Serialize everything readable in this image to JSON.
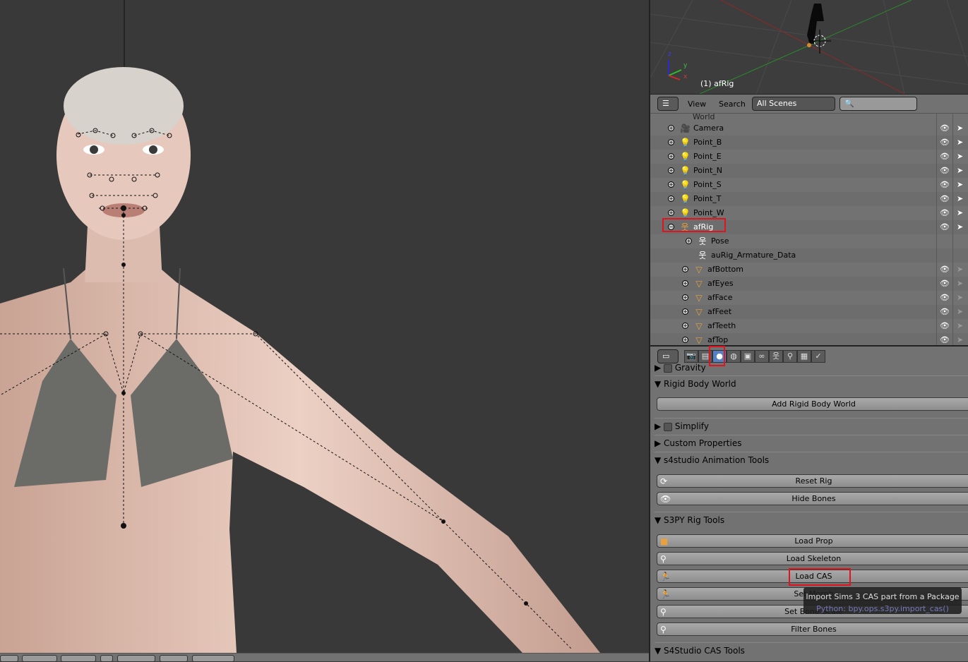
{
  "viewport": {
    "mini_label": "(1) afRig",
    "axes": {
      "x": "x",
      "y": "y",
      "z": "z"
    }
  },
  "outliner": {
    "header": {
      "view": "View",
      "search": "Search",
      "scene_select": "All Scenes",
      "search_placeholder": ""
    },
    "partial_top": "World",
    "items": [
      {
        "name": "Camera",
        "type": "camera"
      },
      {
        "name": "Point_B",
        "type": "lamp"
      },
      {
        "name": "Point_E",
        "type": "lamp"
      },
      {
        "name": "Point_N",
        "type": "lamp"
      },
      {
        "name": "Point_S",
        "type": "lamp"
      },
      {
        "name": "Point_T",
        "type": "lamp"
      },
      {
        "name": "Point_W",
        "type": "lamp"
      },
      {
        "name": "afRig",
        "type": "armature",
        "expanded": true,
        "highlighted": true
      },
      {
        "name": "Pose",
        "type": "pose",
        "child": true
      },
      {
        "name": "auRig_Armature_Data",
        "type": "armature-data",
        "child": true
      },
      {
        "name": "afBottom",
        "type": "mesh",
        "child": true
      },
      {
        "name": "afEyes",
        "type": "mesh",
        "child": true
      },
      {
        "name": "afFace",
        "type": "mesh",
        "child": true
      },
      {
        "name": "afFeet",
        "type": "mesh",
        "child": true
      },
      {
        "name": "afTeeth",
        "type": "mesh",
        "child": true
      },
      {
        "name": "afTop",
        "type": "mesh",
        "child": true
      }
    ]
  },
  "properties": {
    "tabs": [
      "render",
      "render-layers",
      "scene",
      "world",
      "object",
      "constraints",
      "data",
      "bone",
      "texture",
      "physics"
    ],
    "active_tab": "scene",
    "panels": {
      "gravity": "Gravity",
      "rigid_body_world": "Rigid Body World",
      "add_rigid_body_world": "Add Rigid Body World",
      "simplify": "Simplify",
      "custom_properties": "Custom Properties",
      "s4studio_anim": "s4studio Animation Tools",
      "reset_rig": "Reset Rig",
      "hide_bones": "Hide Bones",
      "s3py_rig": "S3PY Rig Tools",
      "load_prop": "Load Prop",
      "load_skeleton": "Load Skeleton",
      "load_cas": "Load CAS",
      "set_morph": "Set Morph",
      "set_bone_scale": "Set Bone Scale",
      "filter_bones": "Filter Bones",
      "s4studio_cas": "S4Studio CAS Tools"
    },
    "tooltip": {
      "title": "Import Sims 3 CAS part from a Package",
      "python": "Python: bpy.ops.s3py.import_cas()"
    }
  },
  "colors": {
    "highlight": "#e0141e",
    "skin": "#d9b6a8",
    "bikini": "#6b6b68",
    "background": "#393939"
  }
}
